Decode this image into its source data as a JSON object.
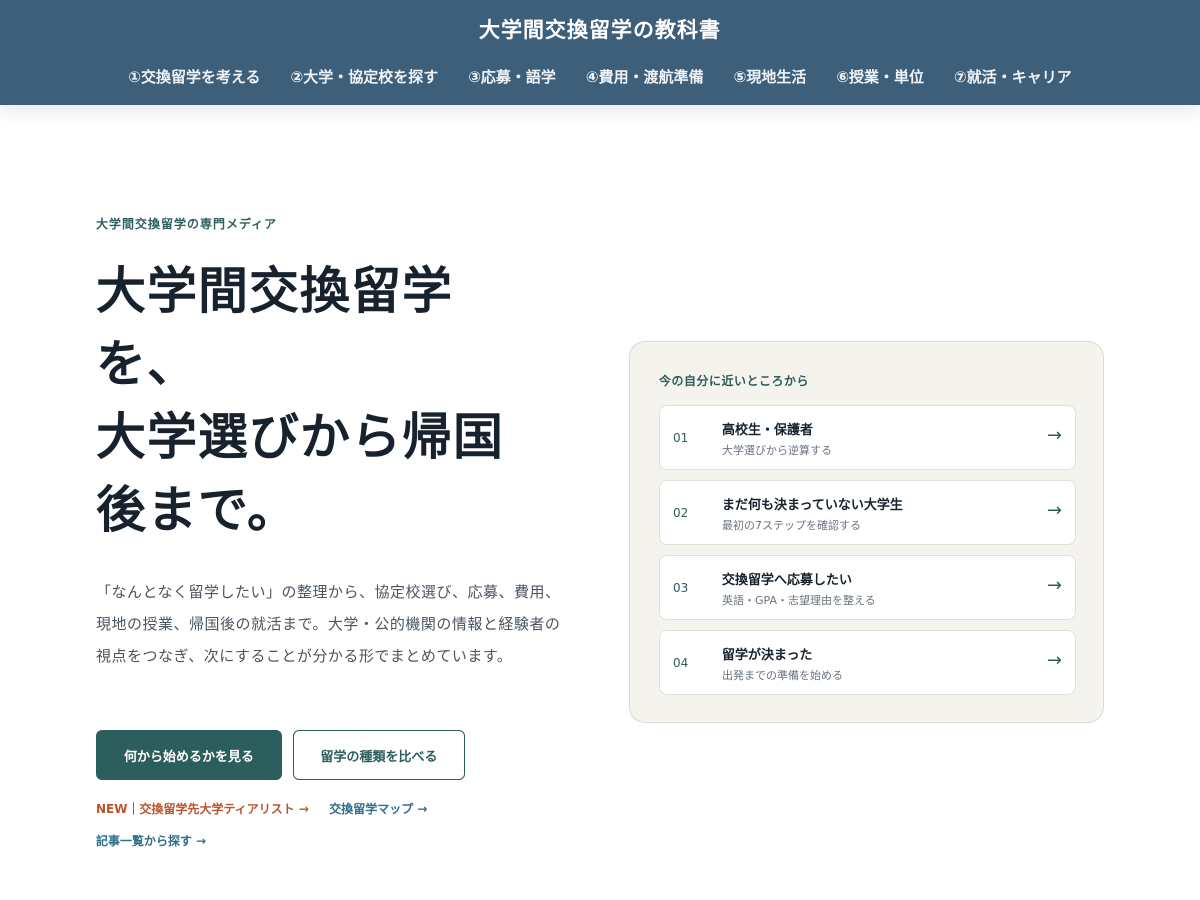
{
  "header": {
    "site_title": "大学間交換留学の教科書",
    "nav": [
      "①交換留学を考える",
      "②大学・協定校を探す",
      "③応募・語学",
      "④費用・渡航準備",
      "⑤現地生活",
      "⑥授業・単位",
      "⑦就活・キャリア"
    ]
  },
  "hero": {
    "eyebrow": "大学間交換留学の専門メディア",
    "title_lines": [
      "大学間交換留学",
      "を、",
      "大学選びから帰国",
      "後まで。"
    ],
    "lead": "「なんとなく留学したい」の整理から、協定校選び、応募、費用、現地の授業、帰国後の就活まで。大学・公的機関の情報と経験者の視点をつなぎ、次にすることが分かる形でまとめています。",
    "primary_button": "何から始めるかを見る",
    "secondary_button": "留学の種類を比べる",
    "link_new": "NEW｜交換留学先大学ティアリスト →",
    "link_map": "交換留学マップ →",
    "link_articles": "記事一覧から探す →"
  },
  "panel": {
    "heading": "今の自分に近いところから",
    "items": [
      {
        "num": "01",
        "title": "高校生・保護者",
        "sub": "大学選びから逆算する",
        "arrow": "→"
      },
      {
        "num": "02",
        "title": "まだ何も決まっていない大学生",
        "sub": "最初の7ステップを確認する",
        "arrow": "→"
      },
      {
        "num": "03",
        "title": "交換留学へ応募したい",
        "sub": "英語・GPA・志望理由を整える",
        "arrow": "→"
      },
      {
        "num": "04",
        "title": "留学が決まった",
        "sub": "出発までの準備を始める",
        "arrow": "→"
      }
    ]
  }
}
